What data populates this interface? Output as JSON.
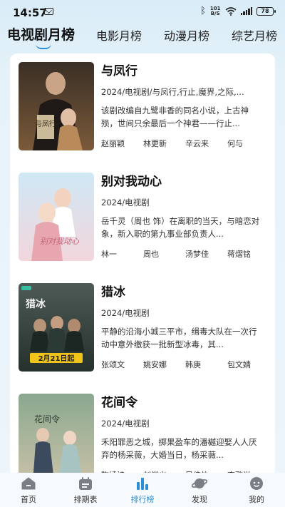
{
  "status_bar": {
    "time": "14:57",
    "net_speed_top": "101",
    "net_speed_bottom": "B/S",
    "battery": "78"
  },
  "tabs": [
    {
      "label": "电视剧月榜",
      "active": true
    },
    {
      "label": "电影月榜",
      "active": false
    },
    {
      "label": "动漫月榜",
      "active": false
    },
    {
      "label": "综艺月榜",
      "active": false
    }
  ],
  "items": [
    {
      "title": "与凤行",
      "meta": "2024/电视剧/与凤行,行止,魔界,之际,...",
      "desc": "该剧改编自九鹭非香的同名小说，上古神殒，世间只余最后一个神君——行止...",
      "cast": [
        "赵丽颖",
        "林更新",
        "辛云来",
        "何与"
      ],
      "poster_text": "与凤行"
    },
    {
      "title": "别对我动心",
      "meta": "2024/电视剧",
      "desc": "岳千灵（周也 饰）在离职的当天，与暗恋对象，新入职的第九事业部负责人...",
      "cast": [
        "林一",
        "周也",
        "汤梦佳",
        "蒋熠铭"
      ],
      "poster_text": "别对我动心"
    },
    {
      "title": "猎冰",
      "meta": "2024/电视剧",
      "desc": "平静的沿海小城三平市，缉毒大队在一次行动中意外缴获一批新型冰毒，其...",
      "cast": [
        "张颂文",
        "姚安娜",
        "韩庚",
        "包文婧"
      ],
      "poster_text": "猎冰",
      "poster_date": "2月21日起"
    },
    {
      "title": "花间令",
      "meta": "2024/电视剧",
      "desc": "禾阳罪恶之城，掷果盈车的潘樾迎娶人人厌弃的杨采薇，大婚当日，杨采薇...",
      "cast": [
        "鞠婧祎",
        "刘学义",
        "吴佳怡",
        "李歌洋"
      ],
      "poster_text": "花间令"
    }
  ],
  "bottom_nav": [
    {
      "label": "首页",
      "icon": "home-icon",
      "active": false
    },
    {
      "label": "排期表",
      "icon": "calendar-icon",
      "active": false
    },
    {
      "label": "排行榜",
      "icon": "ranking-icon",
      "active": true
    },
    {
      "label": "发现",
      "icon": "planet-icon",
      "active": false
    },
    {
      "label": "我的",
      "icon": "profile-icon",
      "active": false
    }
  ],
  "colors": {
    "accent": "#2a8fd6",
    "background": "#e6f2f9",
    "card": "#ffffff"
  }
}
